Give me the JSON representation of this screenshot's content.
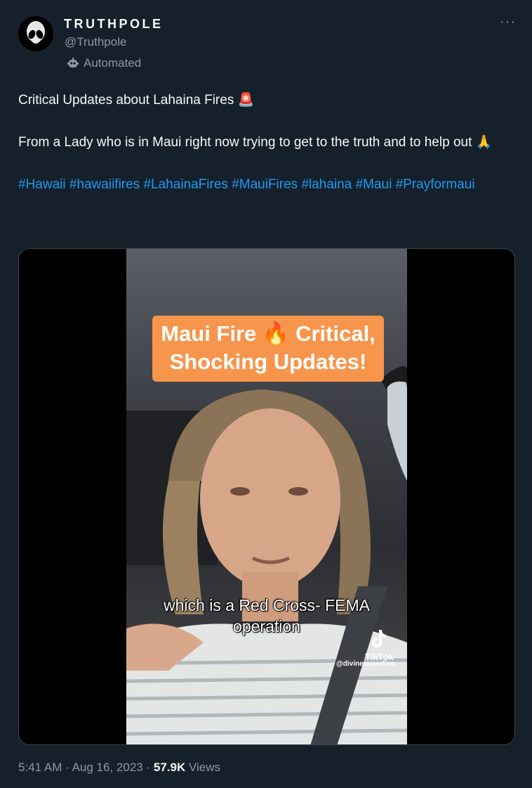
{
  "author": {
    "display_name": "TRUTHPOLE",
    "handle": "@Truthpole",
    "label": "Automated"
  },
  "post": {
    "line1": "Critical Updates about Lahaina Fires",
    "line1_emoji": "🚨",
    "line2": "From a Lady who is in Maui right now trying to get to the truth and to help out",
    "line2_emoji": "🙏",
    "hashtags": [
      "#Hawaii",
      "#hawaiifires",
      "#LahainaFires",
      "#MauiFires",
      "#lahaina",
      "#Maui",
      "#Prayformaui"
    ]
  },
  "video": {
    "title_line1": "Maui Fire 🔥 Critical,",
    "title_line2": "Shocking Updates!",
    "subtitle_line1": "which is a Red Cross- FEMA",
    "subtitle_line2": "operation",
    "watermark": "TikTok",
    "watermark_user": "@divinesuperfine"
  },
  "meta": {
    "time": "5:41 AM",
    "separator": "·",
    "date": "Aug 16, 2023",
    "views_count": "57.9K",
    "views_label": "Views"
  },
  "menu": {
    "more_label": "···"
  },
  "colors": {
    "background": "#15202b",
    "link": "#1d9bf0",
    "muted": "#8b98a5",
    "caption_box": "#f7954c"
  }
}
